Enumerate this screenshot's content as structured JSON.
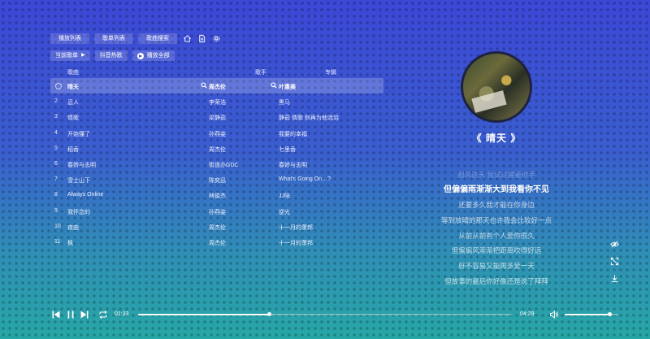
{
  "tabs": [
    {
      "label": "播放列表"
    },
    {
      "label": "歌单列表"
    },
    {
      "label": "歌曲搜索"
    }
  ],
  "tab_icons": [
    "home-icon",
    "document-icon",
    "gear-icon"
  ],
  "breadcrumb": {
    "current_label": "当前歌单",
    "playlist_name": "抖音热歌",
    "play_all_label": "播放全部"
  },
  "table": {
    "headers": {
      "title": "歌曲",
      "artist": "歌手",
      "album": "专辑"
    },
    "rows": [
      {
        "num": "",
        "title": "晴天",
        "artist": "周杰伦",
        "album": "叶惠美",
        "active": true
      },
      {
        "num": "2",
        "title": "忍人",
        "artist": "李荣浩",
        "album": "黑马"
      },
      {
        "num": "3",
        "title": "情歌",
        "artist": "梁静茹",
        "album": "静茹 情歌 别再为他流泪"
      },
      {
        "num": "4",
        "title": "开始懂了",
        "artist": "孙燕姿",
        "album": "我要的幸福"
      },
      {
        "num": "5",
        "title": "稻香",
        "artist": "周杰伦",
        "album": "七里香"
      },
      {
        "num": "6",
        "title": "春娇与志明",
        "artist": "街道办GDC",
        "album": "春娇与志明"
      },
      {
        "num": "7",
        "title": "雪士山下",
        "artist": "陈奕迅",
        "album": "What's Going On…?"
      },
      {
        "num": "8",
        "title": "Always Online",
        "artist": "林俊杰",
        "album": "JJ陆"
      },
      {
        "num": "9",
        "title": "我怀念的",
        "artist": "孙燕姿",
        "album": "逆光"
      },
      {
        "num": "10",
        "title": "夜曲",
        "artist": "周杰伦",
        "album": "十一月的萧邦"
      },
      {
        "num": "11",
        "title": "枫",
        "artist": "周杰伦",
        "album": "十一月的萧邦"
      }
    ]
  },
  "now_playing": {
    "title": "《 晴天 》",
    "lyrics": [
      {
        "text": "刮风这天 我试过握着你手",
        "state": "faded"
      },
      {
        "text": "但偏偏雨渐渐大到我看你不见",
        "state": "current"
      },
      {
        "text": "还要多久我才能在你身边",
        "state": "normal"
      },
      {
        "text": "等到放晴的那天也许我会比较好一点",
        "state": "normal"
      },
      {
        "text": "从前从前有个人爱你很久",
        "state": "normal"
      },
      {
        "text": "但偏偏风渐渐把距离吹得好远",
        "state": "normal"
      },
      {
        "text": "好不容易又能再多爱一天",
        "state": "normal"
      },
      {
        "text": "但故事的最后你好像还是说了拜拜",
        "state": "normal"
      }
    ],
    "side_icons": [
      "eye-icon",
      "expand-icon",
      "download-icon"
    ]
  },
  "player": {
    "current_time": "01:33",
    "total_time": "04:29",
    "progress": 0.35,
    "volume": 0.84
  },
  "colors": {
    "bg_top": "#3c47d6",
    "bg_bottom": "#27a7a6",
    "cover_border": "#1c2240"
  }
}
